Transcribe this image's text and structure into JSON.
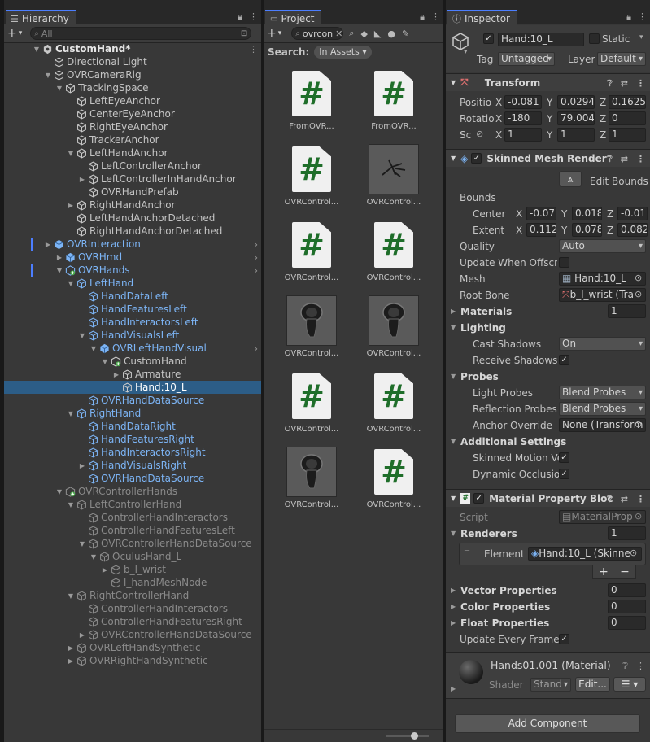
{
  "hierarchy": {
    "tab_label": "Hierarchy",
    "search_placeholder": "All",
    "add_label": "+",
    "rows": [
      {
        "label": "CustomHand*",
        "depth": 0,
        "fold": "open",
        "style": "w",
        "icon": "unity-scene-icon",
        "menu": true
      },
      {
        "label": "Directional Light",
        "depth": 1,
        "fold": "",
        "style": "n",
        "icon": "gameobject-icon"
      },
      {
        "label": "OVRCameraRig",
        "depth": 1,
        "fold": "open",
        "style": "n",
        "icon": "gameobject-icon"
      },
      {
        "label": "TrackingSpace",
        "depth": 2,
        "fold": "open",
        "style": "n",
        "icon": "gameobject-icon"
      },
      {
        "label": "LeftEyeAnchor",
        "depth": 3,
        "fold": "",
        "style": "n",
        "icon": "gameobject-icon"
      },
      {
        "label": "CenterEyeAnchor",
        "depth": 3,
        "fold": "",
        "style": "n",
        "icon": "gameobject-icon"
      },
      {
        "label": "RightEyeAnchor",
        "depth": 3,
        "fold": "",
        "style": "n",
        "icon": "gameobject-icon"
      },
      {
        "label": "TrackerAnchor",
        "depth": 3,
        "fold": "",
        "style": "n",
        "icon": "gameobject-icon"
      },
      {
        "label": "LeftHandAnchor",
        "depth": 3,
        "fold": "open",
        "style": "n",
        "icon": "gameobject-icon"
      },
      {
        "label": "LeftControllerAnchor",
        "depth": 4,
        "fold": "",
        "style": "n",
        "icon": "gameobject-icon"
      },
      {
        "label": "LeftControllerInHandAnchor",
        "depth": 4,
        "fold": "closed",
        "style": "n",
        "icon": "gameobject-icon"
      },
      {
        "label": "OVRHandPrefab",
        "depth": 4,
        "fold": "",
        "style": "n",
        "icon": "gameobject-icon"
      },
      {
        "label": "RightHandAnchor",
        "depth": 3,
        "fold": "closed",
        "style": "n",
        "icon": "gameobject-icon"
      },
      {
        "label": "LeftHandAnchorDetached",
        "depth": 3,
        "fold": "",
        "style": "n",
        "icon": "gameobject-icon"
      },
      {
        "label": "RightHandAnchorDetached",
        "depth": 3,
        "fold": "",
        "style": "n",
        "icon": "gameobject-icon"
      },
      {
        "label": "OVRInteraction",
        "depth": 1,
        "fold": "closed",
        "style": "p",
        "icon": "prefab-icon",
        "chevron": true,
        "mark": true
      },
      {
        "label": "OVRHmd",
        "depth": 2,
        "fold": "closed",
        "style": "p",
        "icon": "prefab-icon",
        "chevron": true
      },
      {
        "label": "OVRHands",
        "depth": 2,
        "fold": "open",
        "style": "p",
        "icon": "prefab-added-icon",
        "chevron": true,
        "mark": true
      },
      {
        "label": "LeftHand",
        "depth": 3,
        "fold": "open",
        "style": "p",
        "icon": "gameobject-icon"
      },
      {
        "label": "HandDataLeft",
        "depth": 4,
        "fold": "",
        "style": "p",
        "icon": "gameobject-icon"
      },
      {
        "label": "HandFeaturesLeft",
        "depth": 4,
        "fold": "",
        "style": "p",
        "icon": "gameobject-icon"
      },
      {
        "label": "HandInteractorsLeft",
        "depth": 4,
        "fold": "",
        "style": "p",
        "icon": "gameobject-icon"
      },
      {
        "label": "HandVisualsLeft",
        "depth": 4,
        "fold": "open",
        "style": "p",
        "icon": "gameobject-icon"
      },
      {
        "label": "OVRLeftHandVisual",
        "depth": 5,
        "fold": "open",
        "style": "p",
        "icon": "prefab-icon",
        "chevron": true
      },
      {
        "label": "CustomHand",
        "depth": 6,
        "fold": "open",
        "style": "n",
        "icon": "prefab-added-icon"
      },
      {
        "label": "Armature",
        "depth": 7,
        "fold": "closed",
        "style": "n",
        "icon": "gameobject-icon"
      },
      {
        "label": "Hand:10_L",
        "depth": 7,
        "fold": "",
        "style": "n",
        "icon": "gameobject-icon",
        "selected": true
      },
      {
        "label": "OVRHandDataSource",
        "depth": 4,
        "fold": "",
        "style": "p",
        "icon": "gameobject-icon"
      },
      {
        "label": "RightHand",
        "depth": 3,
        "fold": "open",
        "style": "p",
        "icon": "gameobject-icon"
      },
      {
        "label": "HandDataRight",
        "depth": 4,
        "fold": "",
        "style": "p",
        "icon": "gameobject-icon"
      },
      {
        "label": "HandFeaturesRight",
        "depth": 4,
        "fold": "",
        "style": "p",
        "icon": "gameobject-icon"
      },
      {
        "label": "HandInteractorsRight",
        "depth": 4,
        "fold": "",
        "style": "p",
        "icon": "gameobject-icon"
      },
      {
        "label": "HandVisualsRight",
        "depth": 4,
        "fold": "closed",
        "style": "p",
        "icon": "gameobject-icon"
      },
      {
        "label": "OVRHandDataSource",
        "depth": 4,
        "fold": "",
        "style": "p",
        "icon": "gameobject-icon"
      },
      {
        "label": "OVRControllerHands",
        "depth": 2,
        "fold": "open",
        "style": "d",
        "icon": "prefab-added-icon"
      },
      {
        "label": "LeftControllerHand",
        "depth": 3,
        "fold": "open",
        "style": "d",
        "icon": "gameobject-icon"
      },
      {
        "label": "ControllerHandInteractors",
        "depth": 4,
        "fold": "",
        "style": "d",
        "icon": "gameobject-icon"
      },
      {
        "label": "ControllerHandFeaturesLeft",
        "depth": 4,
        "fold": "",
        "style": "d",
        "icon": "gameobject-icon"
      },
      {
        "label": "OVRControllerHandDataSource",
        "depth": 4,
        "fold": "open",
        "style": "d",
        "icon": "gameobject-icon"
      },
      {
        "label": "OculusHand_L",
        "depth": 5,
        "fold": "open",
        "style": "d",
        "icon": "gameobject-icon"
      },
      {
        "label": "b_l_wrist",
        "depth": 6,
        "fold": "closed",
        "style": "d",
        "icon": "gameobject-icon"
      },
      {
        "label": "l_handMeshNode",
        "depth": 6,
        "fold": "",
        "style": "d",
        "icon": "gameobject-icon"
      },
      {
        "label": "RightControllerHand",
        "depth": 3,
        "fold": "open",
        "style": "d",
        "icon": "gameobject-icon"
      },
      {
        "label": "ControllerHandInteractors",
        "depth": 4,
        "fold": "",
        "style": "d",
        "icon": "gameobject-icon"
      },
      {
        "label": "ControllerHandFeaturesRight",
        "depth": 4,
        "fold": "",
        "style": "d",
        "icon": "gameobject-icon"
      },
      {
        "label": "OVRControllerHandDataSource",
        "depth": 4,
        "fold": "closed",
        "style": "d",
        "icon": "gameobject-icon"
      },
      {
        "label": "OVRLeftHandSynthetic",
        "depth": 3,
        "fold": "closed",
        "style": "d",
        "icon": "gameobject-icon"
      },
      {
        "label": "OVRRightHandSynthetic",
        "depth": 3,
        "fold": "closed",
        "style": "d",
        "icon": "gameobject-icon"
      }
    ]
  },
  "project": {
    "tab_label": "Project",
    "search_value": "ovrcon",
    "search_label": "Search:",
    "scope_label": "In Assets",
    "items": [
      {
        "label": "FromOVR...",
        "kind": "script"
      },
      {
        "label": "FromOVR...",
        "kind": "script"
      },
      {
        "label": "OVRControl...",
        "kind": "script"
      },
      {
        "label": "OVRControl...",
        "kind": "skeleton"
      },
      {
        "label": "OVRControl...",
        "kind": "script"
      },
      {
        "label": "OVRControl...",
        "kind": "script"
      },
      {
        "label": "OVRControl...",
        "kind": "model"
      },
      {
        "label": "OVRControl...",
        "kind": "model"
      },
      {
        "label": "OVRControl...",
        "kind": "script"
      },
      {
        "label": "OVRControl...",
        "kind": "script"
      },
      {
        "label": "OVRControl...",
        "kind": "model"
      },
      {
        "label": "OVRControl...",
        "kind": "script"
      }
    ]
  },
  "inspector": {
    "tab_label": "Inspector",
    "object_name": "Hand:10_L",
    "static_label": "Static",
    "tag_label": "Tag",
    "tag_value": "Untagged",
    "layer_label": "Layer",
    "layer_value": "Default",
    "transform": {
      "title": "Transform",
      "position_label": "Positio",
      "rotation_label": "Rotatio",
      "scale_label": "Sc",
      "position": {
        "x": "-0.081",
        "y": "0.0294",
        "z": "0.1625"
      },
      "rotation": {
        "x": "-180",
        "y": "79.004",
        "z": "0"
      },
      "scale": {
        "x": "1",
        "y": "1",
        "z": "1"
      }
    },
    "smr": {
      "title": "Skinned Mesh Render",
      "edit_bounds": "Edit Bounds",
      "bounds_label": "Bounds",
      "center_label": "Center",
      "extent_label": "Extent",
      "center": {
        "x": "-0.07",
        "y": "0.018",
        "z": "-0.01"
      },
      "extent": {
        "x": "0.112",
        "y": "0.078",
        "z": "0.082"
      },
      "quality_label": "Quality",
      "quality_value": "Auto",
      "update_offscreen_label": "Update When Offscre",
      "mesh_label": "Mesh",
      "mesh_value": "Hand:10_L",
      "root_bone_label": "Root Bone",
      "root_bone_value": "b_l_wrist (Tra",
      "materials_label": "Materials",
      "materials_count": "1",
      "lighting_label": "Lighting",
      "cast_shadows_label": "Cast Shadows",
      "cast_shadows_value": "On",
      "receive_shadows_label": "Receive Shadows",
      "probes_label": "Probes",
      "light_probes_label": "Light Probes",
      "light_probes_value": "Blend Probes",
      "reflection_probes_label": "Reflection Probes",
      "reflection_probes_value": "Blend Probes",
      "anchor_override_label": "Anchor Override",
      "anchor_override_value": "None (Transform",
      "additional_label": "Additional Settings",
      "skinned_motion_label": "Skinned Motion Ve",
      "dynamic_occlusion_label": "Dynamic Occlusio"
    },
    "mpb": {
      "title": "Material Property Bloc",
      "script_label": "Script",
      "script_value": "MaterialProp",
      "renderers_label": "Renderers",
      "renderers_count": "1",
      "element_label": "Element (",
      "element_value": "Hand:10_L (Skinne",
      "plus": "+",
      "minus": "−",
      "vector_label": "Vector Properties",
      "vector_count": "0",
      "color_label": "Color Properties",
      "color_count": "0",
      "float_label": "Float Properties",
      "float_count": "0",
      "update_every_frame_label": "Update Every Frame"
    },
    "material": {
      "title": "Hands01.001 (Material)",
      "shader_label": "Shader",
      "shader_value": "Stand",
      "edit_label": "Edit..."
    },
    "add_component": "Add Component"
  }
}
